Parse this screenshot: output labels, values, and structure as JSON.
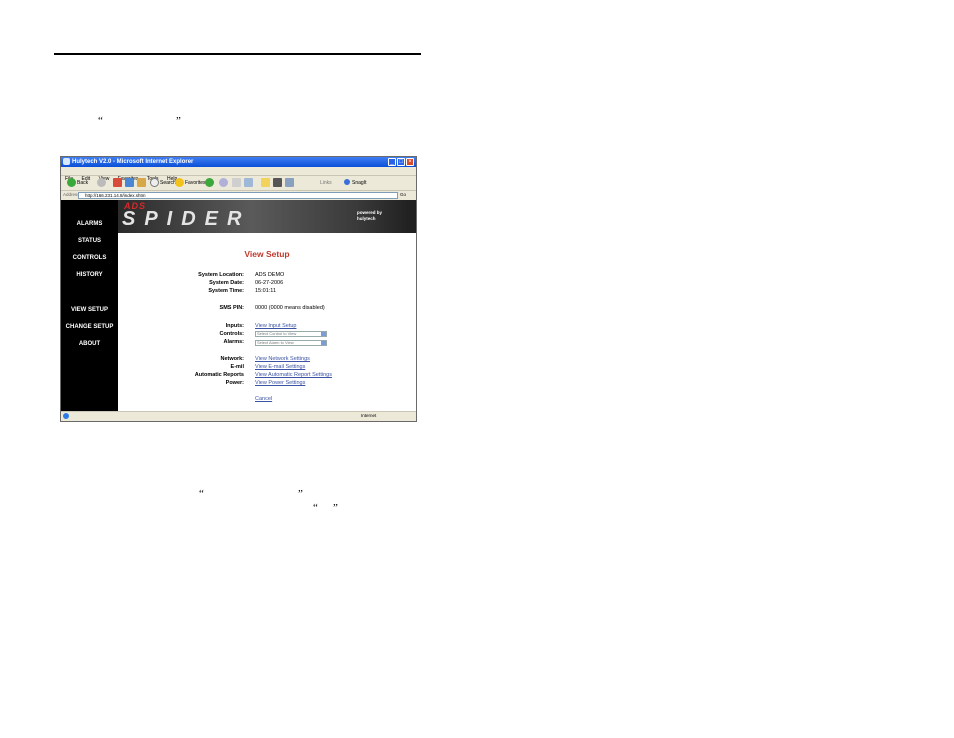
{
  "document": {
    "quotes_top": [
      "“",
      "”"
    ],
    "quotes_mid": [
      "“",
      "”"
    ],
    "quotes_low": [
      "“",
      "”"
    ]
  },
  "window": {
    "title": "Hulytech V2.0 - Microsoft Internet Explorer",
    "menu": [
      "File",
      "Edit",
      "View",
      "Favorites",
      "Tools",
      "Help"
    ],
    "toolbar": {
      "back": "Back",
      "search": "Search",
      "favorites": "Favorites",
      "links": "Links",
      "snagit": "SnagIt"
    },
    "address_label": "Address",
    "address": "http://166.231.14.8/index.shtm",
    "go": "Go",
    "status_zone": "Internet"
  },
  "app": {
    "brand_top": "ADS",
    "brand_main": "SPIDER",
    "powered_line1": "powered by",
    "powered_line2": "hulytech",
    "nav": [
      "ALARMS",
      "STATUS",
      "CONTROLS",
      "HISTORY",
      "VIEW SETUP",
      "CHANGE SETUP",
      "ABOUT"
    ],
    "heading": "View Setup",
    "system": {
      "location_label": "System Location:",
      "location": "ADS DEMO",
      "date_label": "System Date:",
      "date": "06-27-2006",
      "time_label": "System Time:",
      "time": "15:01:11",
      "sms_label": "SMS PIN:",
      "sms": "0000 (0000 means disabled)"
    },
    "setup": {
      "inputs_label": "Inputs:",
      "inputs_link": "View Input Setup",
      "controls_label": "Controls:",
      "controls_select": "Select Control to View",
      "alarms_label": "Alarms:",
      "alarms_select": "Select Alarm to View",
      "network_label": "Network:",
      "network_link": "View Network Settings",
      "email_label": "E-mil",
      "email_link": "View E-mail Settings",
      "auto_label": "Automatic Reports",
      "auto_link": "View Automatic Report Settings",
      "power_label": "Power:",
      "power_link": "View Power Settings",
      "cancel": "Cancel"
    }
  }
}
